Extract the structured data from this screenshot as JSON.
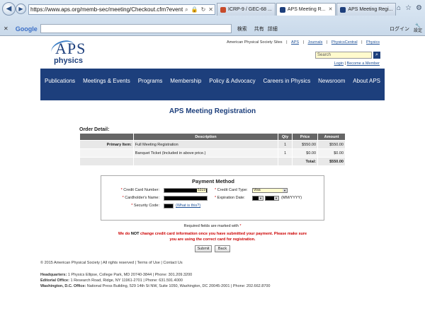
{
  "browser": {
    "address": "https://www.aps.org/memb-sec/meeting/Checkout.cfm?event",
    "tabs": [
      {
        "title": "ICRP-9 / GEC-68 ...",
        "color": "#c74b2b",
        "active": false
      },
      {
        "title": "APS Meeting R...",
        "color": "#1d3f7c",
        "active": true
      },
      {
        "title": "APS Meeting Regi...",
        "color": "#1d3f7c",
        "active": false
      }
    ],
    "google_bar": {
      "logo": "Google",
      "search_label": "検索",
      "share_label": "共有",
      "detail_label": "詳細",
      "login_label": "ログイン",
      "settings_label": "設定"
    }
  },
  "header": {
    "logo_main": "APS",
    "logo_sub": "physics",
    "sites_label": "American Physical Society Sites",
    "links": [
      "APS",
      "Journals",
      "PhysicsCentral",
      "Physics"
    ],
    "search_placeholder": "Search",
    "login": "Login",
    "become_member": "Become a Member"
  },
  "nav": [
    "Publications",
    "Meetings & Events",
    "Programs",
    "Membership",
    "Policy & Advocacy",
    "Careers in Physics",
    "Newsroom",
    "About APS"
  ],
  "registration": {
    "title": "APS Meeting Registration",
    "order_label": "Order Detail:",
    "table": {
      "headers": [
        "",
        "Description",
        "Qty",
        "Price",
        "Amount"
      ],
      "rows": [
        [
          "Primary Item:",
          "Full Meeting Registration",
          "1",
          "$550.00",
          "$550.00"
        ],
        [
          "",
          "Banquet Ticket (Included in above price.)",
          "1",
          "$0.00",
          "$0.00"
        ],
        [
          "",
          "",
          "",
          "Total:",
          "$550.00"
        ]
      ]
    },
    "payment": {
      "title": "Payment Method",
      "card_number_label": "Credit Card Number:",
      "card_number_suffix": "5319",
      "cardholder_label": "Cardholder's Name:",
      "security_code_label": "Security Code:",
      "what_is_this": "(What is this?)",
      "card_type_label": "Credit Card Type:",
      "card_type_value": "Visa",
      "expiration_label": "Expiration Date:",
      "expiration_format": "(MM/YYYY)"
    },
    "required_note": "Required fields are marked with",
    "warning_prefix": "We do ",
    "warning_not": "NOT",
    "warning_rest": " change credit card information once you have submitted your payment. Please make sure",
    "warning_line2": "you are using the correct card for registration.",
    "submit_label": "Submit",
    "back_label": "Back"
  },
  "footer": {
    "copyright": "© 2015  American Physical Society",
    "links": [
      "All rights reserved",
      "Terms of Use",
      "Contact Us"
    ],
    "addresses": [
      {
        "label": "Headquarters:",
        "text": "1 Physics Ellipse, College Park, MD 20740-3844 | Phone: 301.209.3200"
      },
      {
        "label": "Editorial Office:",
        "text": "1 Research Road, Ridge, NY 11961-2701 | Phone: 631.591.4000"
      },
      {
        "label": "Washington, D.C. Office:",
        "text": "National Press Building, 529 14th St NW, Suite 1050, Washington, DC 20045-2001 | Phone: 202.662.8700"
      }
    ]
  }
}
